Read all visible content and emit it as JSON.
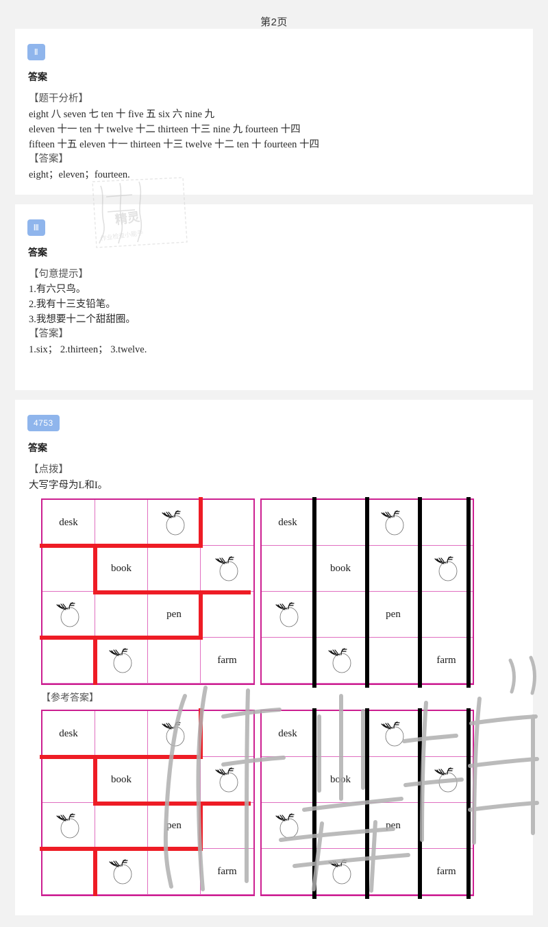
{
  "page": {
    "title": "第2页"
  },
  "sections": [
    {
      "badge": "Ⅱ",
      "answer_label": "答案",
      "blocks": [
        {
          "type": "header",
          "text": "【题干分析】"
        },
        {
          "type": "line",
          "text": "eight 八  seven 七  ten 十  five 五  six 六  nine 九"
        },
        {
          "type": "line",
          "text": "eleven 十一  ten 十  twelve 十二  thirteen 十三  nine 九  fourteen 十四"
        },
        {
          "type": "line",
          "text": "fifteen 十五  eleven 十一  thirteen 十三  twelve 十二  ten 十  fourteen 十四"
        },
        {
          "type": "header",
          "text": "【答案】"
        },
        {
          "type": "line",
          "text": "eight；eleven；fourteen."
        }
      ]
    },
    {
      "badge": "Ⅲ",
      "answer_label": "答案",
      "blocks": [
        {
          "type": "header",
          "text": "【句意提示】"
        },
        {
          "type": "line",
          "text": "1.有六只鸟。"
        },
        {
          "type": "line",
          "text": "2.我有十三支铅笔。"
        },
        {
          "type": "line",
          "text": "3.我想要十二个甜甜圈。"
        },
        {
          "type": "header",
          "text": "【答案】"
        },
        {
          "type": "line",
          "text": "1.six；  2.thirteen；  3.twelve."
        }
      ]
    },
    {
      "badge": "4753",
      "answer_label": "答案",
      "blocks": [
        {
          "type": "header",
          "text": "【点拨】"
        },
        {
          "type": "line",
          "text": "大写字母为L和I。"
        }
      ],
      "reference_label": "【参考答案】"
    }
  ],
  "grid": {
    "rows": [
      [
        "desk",
        "",
        "apple-icon",
        ""
      ],
      [
        "",
        "book",
        "",
        "apple-icon"
      ],
      [
        "apple-icon",
        "",
        "pen",
        ""
      ],
      [
        "",
        "apple-icon",
        "",
        "farm"
      ]
    ],
    "left_stroke_color": "#ee1c25",
    "right_stroke_color": "#000000",
    "border_color": "#cc1f90",
    "inner_line_color": "#e06ec0",
    "left_shape": "L",
    "right_shape": "I"
  },
  "watermark": {
    "stamp_text": "作业精灵 作业检查小能手",
    "big_text": "作业精灵"
  },
  "colors": {
    "badge_bg": "#8fb5ec",
    "badge_text": "#ffffff",
    "card_bg": "#ffffff",
    "page_bg": "#f2f2f2"
  }
}
